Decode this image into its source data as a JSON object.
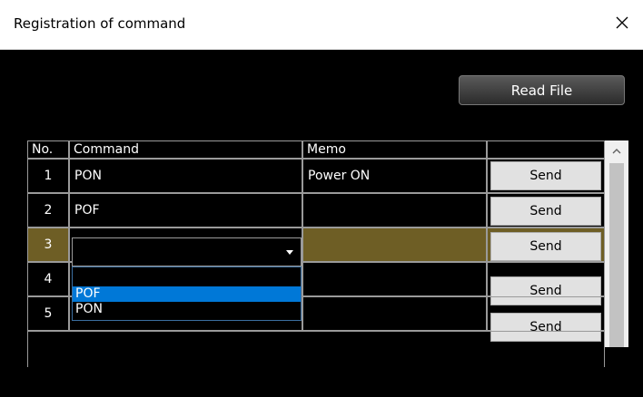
{
  "window": {
    "title": "Registration of command",
    "close_glyph": "✕"
  },
  "toolbar": {
    "read_file_label": "Read File"
  },
  "table": {
    "headers": {
      "no": "No.",
      "command": "Command",
      "memo": "Memo",
      "action": ""
    },
    "rows": [
      {
        "no": "1",
        "command": "PON",
        "memo": "Power ON",
        "send": "Send"
      },
      {
        "no": "2",
        "command": "POF",
        "memo": "",
        "send": "Send"
      },
      {
        "no": "3",
        "command": "",
        "memo": "",
        "send": "Send",
        "selected": true
      },
      {
        "no": "4",
        "command": "",
        "memo": "",
        "send": "Send"
      },
      {
        "no": "5",
        "command": "",
        "memo": "",
        "send": "Send"
      }
    ]
  },
  "dropdown": {
    "options": [
      "",
      "POF",
      "PON"
    ],
    "highlighted": "POF"
  },
  "scrollbar": {
    "up_icon": "chevron-up-icon"
  },
  "colors": {
    "selected_row": "#6e5e25",
    "highlight": "#0078d7"
  }
}
